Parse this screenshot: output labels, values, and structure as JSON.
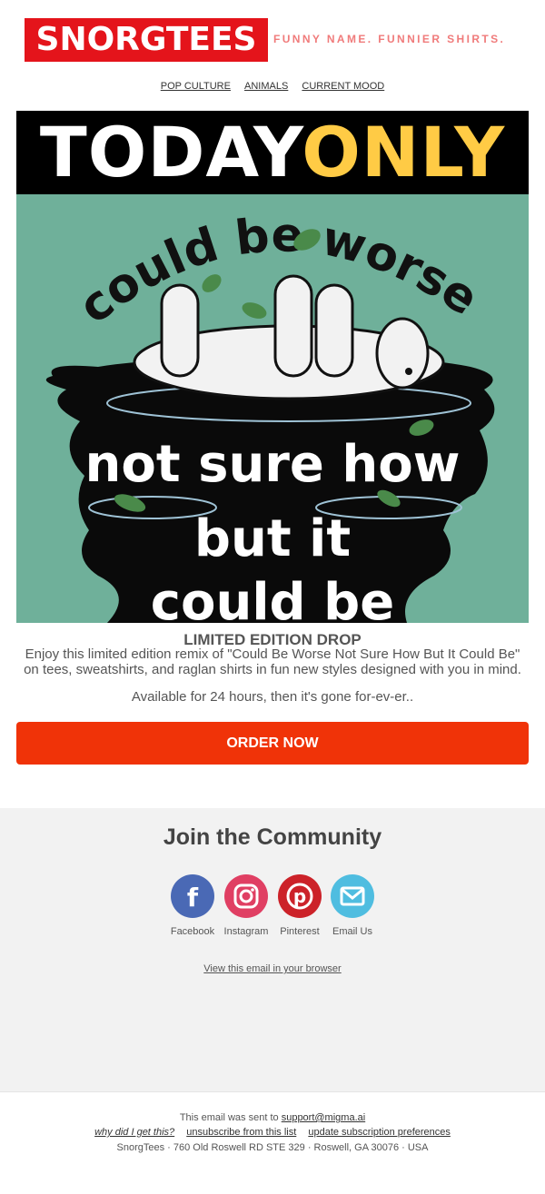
{
  "header": {
    "brand": "SNORGTEES",
    "tagline": "FUNNY NAME. FUNNIER SHIRTS.",
    "brand_color": "#e4141b"
  },
  "nav": {
    "items": [
      "POP CULTURE",
      "ANIMALS",
      "CURRENT MOOD"
    ]
  },
  "hero": {
    "banner_white": "TODAY",
    "banner_yellow": "ONLY",
    "art_arc_text": "could be worse",
    "art_line1": "not sure how",
    "art_line2": "but it",
    "art_line3": "could be",
    "bg_color": "#6fb09a",
    "accent_color": "#ffcb45"
  },
  "promo": {
    "heading": "LIMITED EDITION DROP",
    "description": "Enjoy this limited edition remix of \"Could Be Worse Not Sure How But It Could Be\" on tees, sweatshirts, and raglan shirts in fun new styles designed with you in mind.",
    "availability": "Available for 24 hours, then it's gone for-ev-er..",
    "cta_label": "ORDER NOW",
    "cta_color": "#f03308"
  },
  "community": {
    "title": "Join the Community",
    "socials": [
      {
        "label": "Facebook",
        "icon": "facebook-icon",
        "color": "#4a69b5"
      },
      {
        "label": "Instagram",
        "icon": "instagram-icon",
        "color": "#e03f63"
      },
      {
        "label": "Pinterest",
        "icon": "pinterest-icon",
        "color": "#cc2229"
      },
      {
        "label": "Email Us",
        "icon": "email-icon",
        "color": "#4fbde0"
      }
    ],
    "view_in_browser": "View this email in your browser"
  },
  "footer": {
    "sent_to_prefix": "This email was sent to",
    "email": "support@migma.ai",
    "why": "why did I get this?",
    "unsubscribe": "unsubscribe from this list",
    "preferences": "update subscription preferences",
    "address": "SnorgTees · 760 Old Roswell RD STE 329 · Roswell, GA 30076 · USA"
  }
}
